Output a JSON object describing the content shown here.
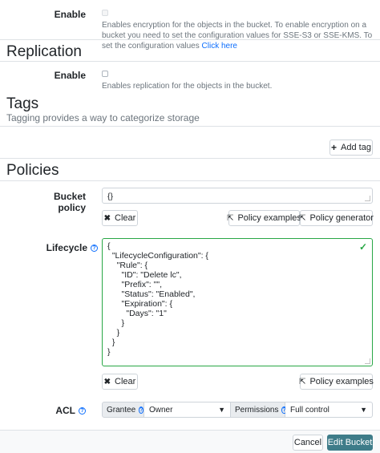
{
  "encryption": {
    "enable_label": "Enable",
    "help": "Enables encryption for the objects in the bucket. To enable encryption on a bucket you need to set the configuration values for SSE-S3 or SSE-KMS. To set the configuration values ",
    "help_link": "Click here"
  },
  "replication": {
    "title": "Replication",
    "enable_label": "Enable",
    "help": "Enables replication for the objects in the bucket."
  },
  "tags": {
    "title": "Tags",
    "subtitle": "Tagging provides a way to categorize storage",
    "add_tag_label": "Add tag"
  },
  "policies": {
    "title": "Policies",
    "bucket_policy_label": "Bucket policy",
    "bucket_policy_value": "{}",
    "clear_label": "Clear",
    "policy_examples_label": "Policy examples",
    "policy_generator_label": "Policy generator",
    "lifecycle_label": "Lifecycle",
    "lifecycle_value": "{\n  \"LifecycleConfiguration\": {\n    \"Rule\": {\n      \"ID\": \"Delete lc\",\n      \"Prefix\": \"\",\n      \"Status\": \"Enabled\",\n      \"Expiration\": {\n        \"Days\": \"1\"\n      }\n    }\n  }\n}",
    "lifecycle_clear_label": "Clear",
    "lifecycle_examples_label": "Policy examples",
    "acl_label": "ACL",
    "grantee_label": "Grantee",
    "grantee_value": "Owner",
    "permissions_label": "Permissions",
    "permissions_value": "Full control"
  },
  "footer": {
    "cancel_label": "Cancel",
    "submit_label": "Edit Bucket"
  },
  "colors": {
    "primary": "#3e7c89",
    "valid": "#28a745",
    "link": "#0d6efd"
  }
}
